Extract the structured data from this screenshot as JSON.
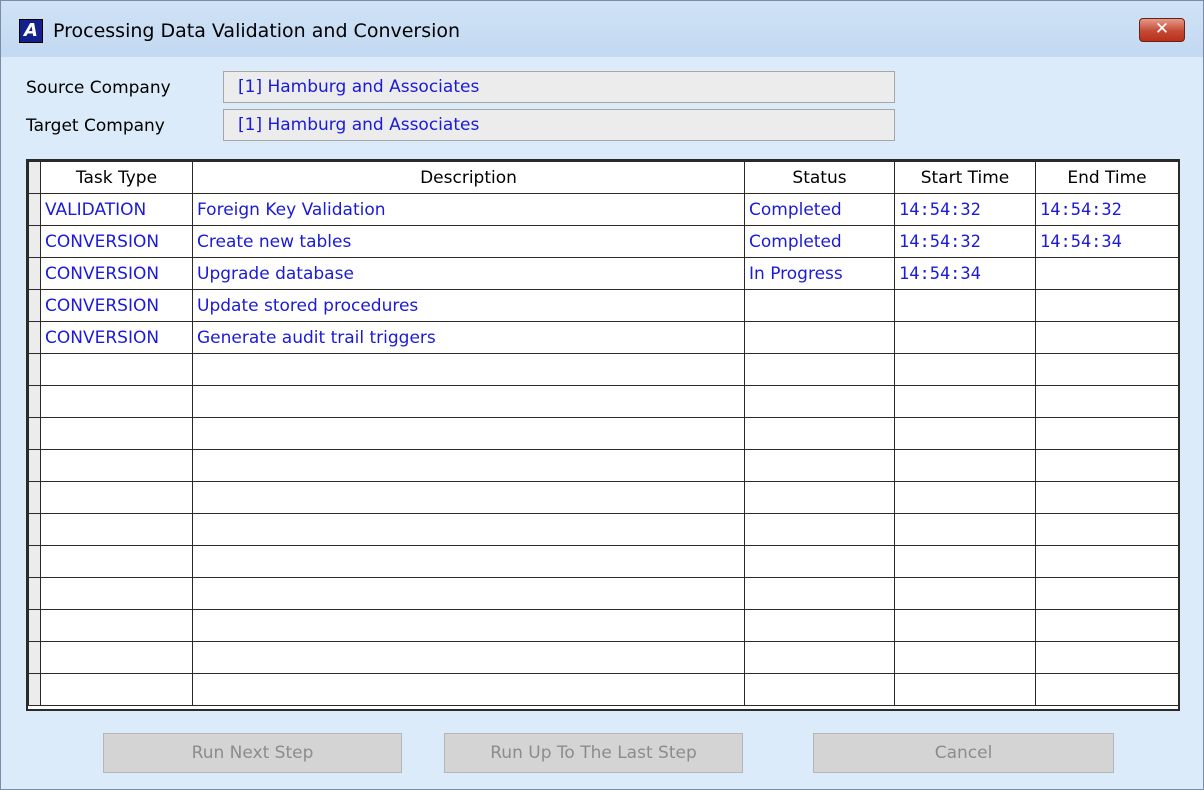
{
  "window": {
    "title": "Processing Data Validation and Conversion",
    "app_icon_letter": "A",
    "close_glyph": "✕"
  },
  "fields": {
    "source_label": "Source Company",
    "source_value": "[1] Hamburg and Associates",
    "target_label": "Target Company",
    "target_value": "[1] Hamburg and Associates"
  },
  "grid": {
    "headers": [
      "Task Type",
      "Description",
      "Status",
      "Start Time",
      "End Time"
    ],
    "rows": [
      [
        "VALIDATION",
        "Foreign Key Validation",
        "Completed",
        "14:54:32",
        "14:54:32"
      ],
      [
        "CONVERSION",
        "Create new tables",
        "Completed",
        "14:54:32",
        "14:54:34"
      ],
      [
        "CONVERSION",
        "Upgrade database",
        "In Progress",
        "14:54:34",
        ""
      ],
      [
        "CONVERSION",
        "Update stored procedures",
        "",
        "",
        ""
      ],
      [
        "CONVERSION",
        "Generate audit trail triggers",
        "",
        "",
        ""
      ],
      [
        "",
        "",
        "",
        "",
        ""
      ],
      [
        "",
        "",
        "",
        "",
        ""
      ],
      [
        "",
        "",
        "",
        "",
        ""
      ],
      [
        "",
        "",
        "",
        "",
        ""
      ],
      [
        "",
        "",
        "",
        "",
        ""
      ],
      [
        "",
        "",
        "",
        "",
        ""
      ],
      [
        "",
        "",
        "",
        "",
        ""
      ],
      [
        "",
        "",
        "",
        "",
        ""
      ],
      [
        "",
        "",
        "",
        "",
        ""
      ],
      [
        "",
        "",
        "",
        "",
        ""
      ],
      [
        "",
        "",
        "",
        "",
        ""
      ]
    ]
  },
  "buttons": {
    "run_next": "Run Next Step",
    "run_up_to_last": "Run Up To The Last Step",
    "cancel": "Cancel"
  },
  "colors": {
    "value_text": "#1a1ad8",
    "background": "#dcebf9",
    "close_button": "#c44a34"
  }
}
